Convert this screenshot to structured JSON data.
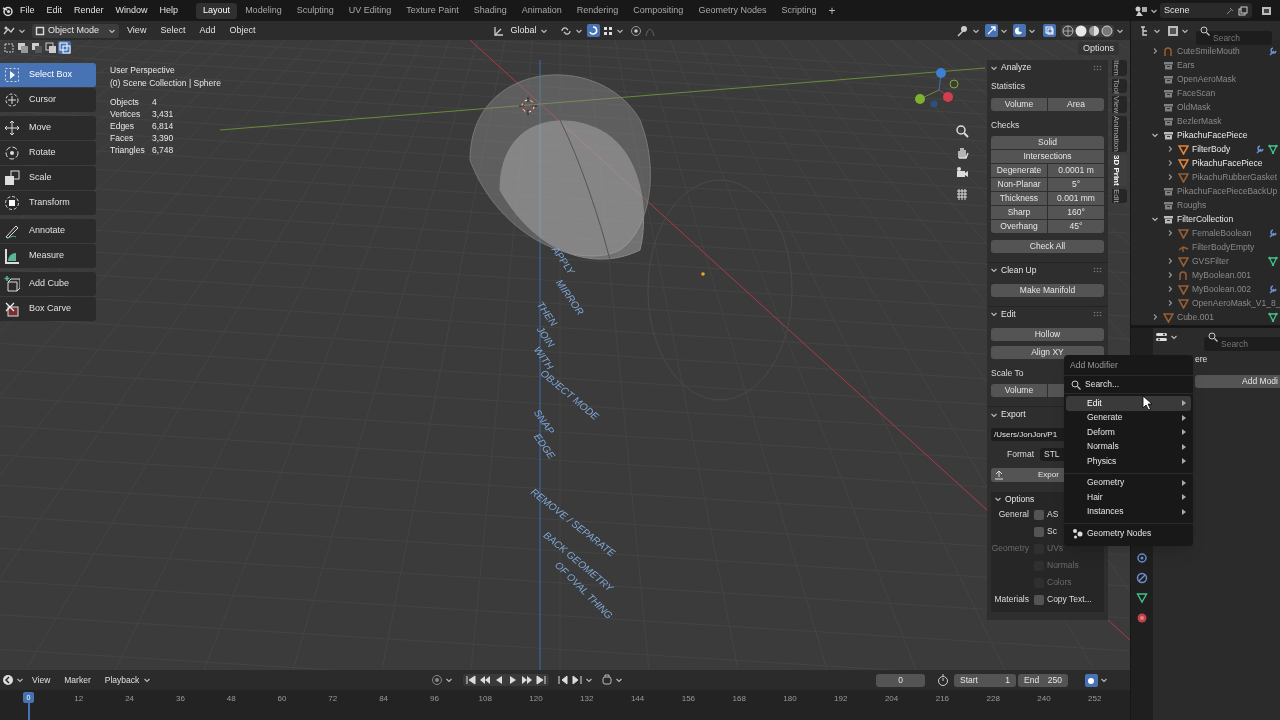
{
  "menu_bar": {
    "menus": [
      "File",
      "Edit",
      "Render",
      "Window",
      "Help"
    ],
    "workspaces": [
      {
        "label": "Layout",
        "selected": true
      },
      {
        "label": "Modeling",
        "selected": false
      },
      {
        "label": "Sculpting",
        "selected": false
      },
      {
        "label": "UV Editing",
        "selected": false
      },
      {
        "label": "Texture Paint",
        "selected": false
      },
      {
        "label": "Shading",
        "selected": false
      },
      {
        "label": "Animation",
        "selected": false
      },
      {
        "label": "Rendering",
        "selected": false
      },
      {
        "label": "Compositing",
        "selected": false
      },
      {
        "label": "Geometry Nodes",
        "selected": false
      },
      {
        "label": "Scripting",
        "selected": false
      }
    ],
    "add_workspace": "+",
    "scene": "Scene"
  },
  "viewport_header": {
    "mode": "Object Mode",
    "menus": [
      "View",
      "Select",
      "Add",
      "Object"
    ],
    "orientation": "Global"
  },
  "viewport": {
    "selection_modes": [
      {
        "selected": false
      },
      {
        "selected": false
      },
      {
        "selected": false
      },
      {
        "selected": false
      },
      {
        "selected": true
      }
    ],
    "options_button": "Options",
    "view_name": "User Perspective",
    "collection": "(0) Scene Collection | Sphere",
    "statistics": [
      {
        "label": "Objects",
        "value": "4"
      },
      {
        "label": "Vertices",
        "value": "3,431"
      },
      {
        "label": "Edges",
        "value": "6,814"
      },
      {
        "label": "Faces",
        "value": "3,390"
      },
      {
        "label": "Triangles",
        "value": "6,748"
      }
    ],
    "annotations": [
      "APPLY",
      "MIRROR",
      "THEN",
      "JOIN",
      "WITH",
      "OBJECT MODE",
      "SNAP",
      "EDGE",
      "REMOVE / SEPARATE",
      "BACK GEOMETRY",
      "OF OVAL THING"
    ]
  },
  "toolbar": {
    "groups": [
      [
        {
          "label": "Select Box",
          "selected": true
        },
        {
          "label": "Cursor",
          "selected": false
        }
      ],
      [
        {
          "label": "Move",
          "selected": false
        },
        {
          "label": "Rotate",
          "selected": false
        },
        {
          "label": "Scale",
          "selected": false
        },
        {
          "label": "Transform",
          "selected": false
        }
      ],
      [
        {
          "label": "Annotate",
          "selected": false
        },
        {
          "label": "Measure",
          "selected": false
        }
      ],
      [
        {
          "label": "Add Cube",
          "selected": false
        },
        {
          "label": "Box Carve",
          "selected": false
        }
      ]
    ]
  },
  "sidebar": {
    "tabs": [
      {
        "label": "Item",
        "selected": false
      },
      {
        "label": "Tool",
        "selected": false
      },
      {
        "label": "View",
        "selected": false
      },
      {
        "label": "Animation",
        "selected": false
      },
      {
        "label": "3D Print",
        "selected": true
      },
      {
        "label": "Edit",
        "selected": false
      }
    ],
    "analyze": {
      "title": "Analyze",
      "statistics_label": "Statistics",
      "statistics_buttons": [
        "Volume",
        "Area"
      ],
      "checks_label": "Checks",
      "check_buttons": [
        "Solid",
        "Intersections"
      ],
      "check_rows": [
        {
          "label": "Degenerate",
          "value": "0.0001 m"
        },
        {
          "label": "Non-Planar",
          "value": "5°"
        },
        {
          "label": "Thickness",
          "value": "0.001 mm"
        },
        {
          "label": "Sharp",
          "value": "160°"
        },
        {
          "label": "Overhang",
          "value": "45°"
        }
      ],
      "check_all": "Check All"
    },
    "clean_up": {
      "title": "Clean Up",
      "button": "Make Manifold"
    },
    "edit": {
      "title": "Edit",
      "buttons": [
        "Hollow",
        "Align XY"
      ],
      "scale_to_label": "Scale To",
      "scale_button": "Volume"
    },
    "export": {
      "title": "Export",
      "path": "/Users/JonJon/P1",
      "format_label": "Format",
      "format": "STL",
      "export_button": "Expor",
      "options_title": "Options",
      "option_groups": [
        {
          "label": "General",
          "disabled": false,
          "options": [
            {
              "label": "AS",
              "checked": false,
              "disabled": false
            },
            {
              "label": "Sc",
              "checked": false,
              "disabled": false
            }
          ]
        },
        {
          "label": "Geometry",
          "disabled": true,
          "options": [
            {
              "label": "UVs",
              "checked": false,
              "disabled": true
            },
            {
              "label": "Normals",
              "checked": false,
              "disabled": true
            },
            {
              "label": "Colors",
              "checked": false,
              "disabled": true
            }
          ]
        },
        {
          "label": "Materials",
          "disabled": false,
          "options": [
            {
              "label": "Copy Text...",
              "checked": false,
              "disabled": false
            }
          ]
        }
      ]
    }
  },
  "outliner": {
    "search_placeholder": "Search",
    "items": [
      {
        "label": "CuteSmileMouth",
        "kind": "curve",
        "expanded": false,
        "dimmed": true,
        "modifier": true,
        "data": false
      },
      {
        "label": "Ears",
        "kind": "collection",
        "dimmed": true,
        "modifier": false,
        "data": false
      },
      {
        "label": "OpenAeroMask",
        "kind": "collection",
        "dimmed": true,
        "modifier": false,
        "data": false
      },
      {
        "label": "FaceScan",
        "kind": "collection",
        "dimmed": true,
        "modifier": false,
        "data": false
      },
      {
        "label": "OldMask",
        "kind": "collection",
        "dimmed": true,
        "modifier": false,
        "data": false
      },
      {
        "label": "BezlerMask",
        "kind": "collection",
        "dimmed": true,
        "modifier": false,
        "data": false
      },
      {
        "label": "PikachuFacePiece",
        "kind": "collection",
        "expanded": true,
        "dimmed": false,
        "modifier": false,
        "data": false,
        "children": [
          {
            "label": "FilterBody",
            "kind": "mesh",
            "expanded": false,
            "dimmed": false,
            "modifier": true,
            "data": true
          },
          {
            "label": "PikachuFacePiece",
            "kind": "mesh",
            "expanded": false,
            "dimmed": false,
            "modifier": false,
            "data": false
          },
          {
            "label": "PikachuRubberGasket",
            "kind": "mesh",
            "expanded": false,
            "dimmed": true,
            "modifier": false,
            "data": false
          }
        ]
      },
      {
        "label": "PikachuFacePieceBackUp",
        "kind": "collection",
        "dimmed": true,
        "modifier": false,
        "data": false
      },
      {
        "label": "Roughs",
        "kind": "collection",
        "dimmed": true,
        "modifier": false,
        "data": false
      },
      {
        "label": "FilterCollection",
        "kind": "collection",
        "expanded": true,
        "dimmed": false,
        "modifier": false,
        "data": false,
        "children": [
          {
            "label": "FemaleBoolean",
            "kind": "mesh",
            "expanded": false,
            "dimmed": true,
            "modifier": true,
            "data": false
          },
          {
            "label": "FilterBodyEmpty",
            "kind": "empty",
            "dimmed": true,
            "modifier": false,
            "data": false
          },
          {
            "label": "GVSFilter",
            "kind": "mesh",
            "expanded": false,
            "dimmed": true,
            "modifier": false,
            "data": true
          },
          {
            "label": "MyBoolean.001",
            "kind": "curve",
            "expanded": false,
            "dimmed": true,
            "modifier": false,
            "data": false
          },
          {
            "label": "MyBoolean.002",
            "kind": "mesh",
            "expanded": false,
            "dimmed": true,
            "modifier": true,
            "data": false
          },
          {
            "label": "OpenAeroMask_V1_8_",
            "kind": "mesh",
            "expanded": false,
            "dimmed": true,
            "modifier": false,
            "data": false
          }
        ]
      },
      {
        "label": "Cube.001",
        "kind": "mesh",
        "expanded": false,
        "dimmed": true,
        "modifier": false,
        "data": true
      }
    ]
  },
  "properties": {
    "search_placeholder": "Search",
    "object_name": "ere",
    "add_modifier_button": "Add Modi"
  },
  "add_modifier_menu": {
    "title": "Add Modifier",
    "search": "Search...",
    "sections": [
      [
        {
          "label": "Edit",
          "kind": "submenu",
          "selected": true
        },
        {
          "label": "Generate",
          "kind": "submenu",
          "selected": false
        },
        {
          "label": "Deform",
          "kind": "submenu",
          "selected": false
        },
        {
          "label": "Normals",
          "kind": "submenu",
          "selected": false
        },
        {
          "label": "Physics",
          "kind": "submenu",
          "selected": false
        }
      ],
      [
        {
          "label": "Geometry",
          "kind": "submenu",
          "selected": false
        },
        {
          "label": "Hair",
          "kind": "submenu",
          "selected": false
        },
        {
          "label": "Instances",
          "kind": "submenu",
          "selected": false
        }
      ],
      [
        {
          "label": "Geometry Nodes",
          "kind": "action",
          "selected": false
        }
      ]
    ]
  },
  "timeline": {
    "menus": [
      "View",
      "Marker"
    ],
    "playback": "Playback",
    "current_frame": "0",
    "start_label": "Start",
    "start": "1",
    "end_label": "End",
    "end": "250",
    "playhead": "0",
    "ticks": [
      "12",
      "24",
      "36",
      "48",
      "60",
      "72",
      "84",
      "96",
      "108",
      "120",
      "132",
      "144",
      "156",
      "168",
      "180",
      "192",
      "204",
      "216",
      "228",
      "240",
      "252"
    ]
  }
}
